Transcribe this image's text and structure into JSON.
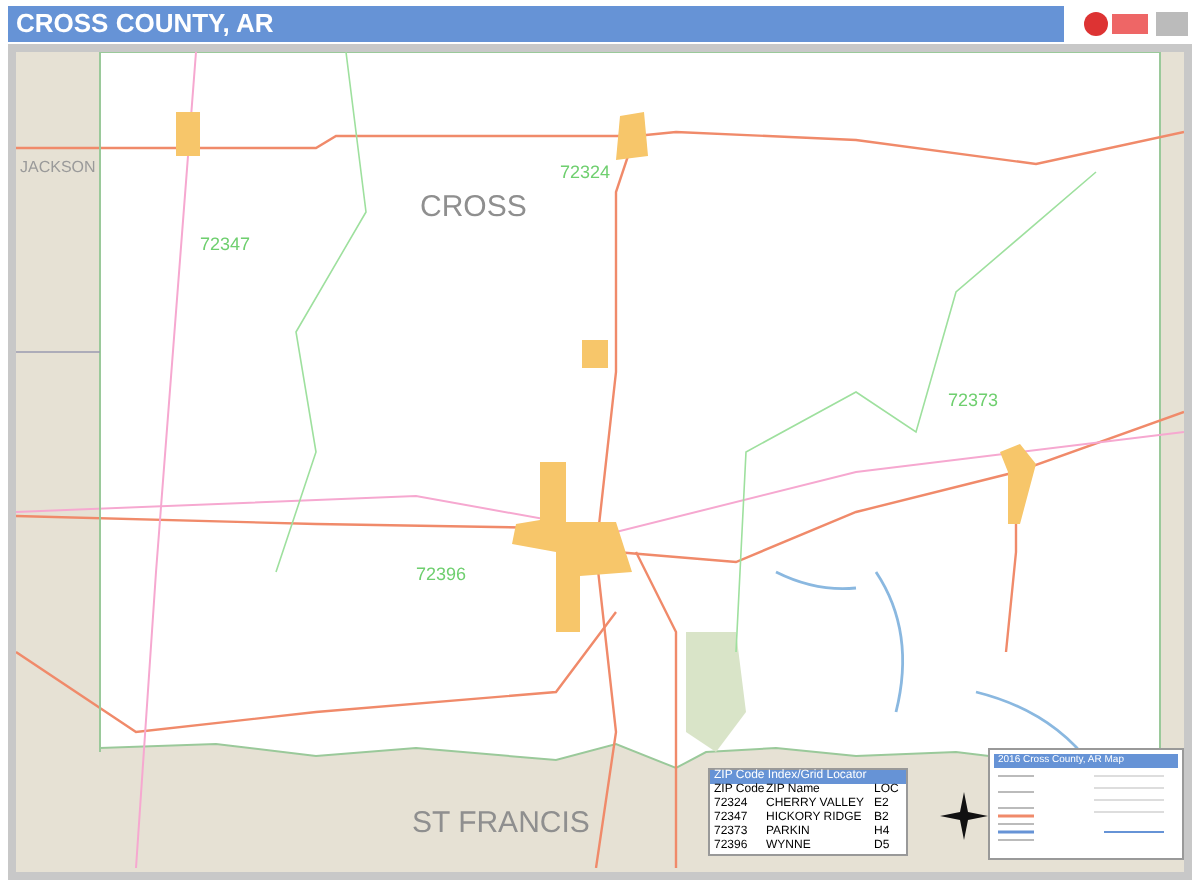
{
  "header": {
    "title": "CROSS COUNTY, AR"
  },
  "map_labels": [
    {
      "text": "JACKSON",
      "kind": "county"
    },
    {
      "text": "CROSS",
      "kind": "county"
    },
    {
      "text": "72324",
      "kind": "zip"
    },
    {
      "text": "72347",
      "kind": "zip"
    },
    {
      "text": "72373",
      "kind": "zip"
    },
    {
      "text": "72396",
      "kind": "zip"
    },
    {
      "text": "ST FRANCIS",
      "kind": "county"
    }
  ],
  "zip_index": {
    "title": "ZIP Code Index/Grid Locator",
    "columns": [
      "ZIP Code",
      "ZIP Name",
      "LOC"
    ],
    "rows": [
      [
        "72324",
        "CHERRY VALLEY",
        "E2"
      ],
      [
        "72347",
        "HICKORY RIDGE",
        "B2"
      ],
      [
        "72373",
        "PARKIN",
        "H4"
      ],
      [
        "72396",
        "WYNNE",
        "D5"
      ]
    ]
  },
  "legend": {
    "title": "2016 Cross County, AR Map"
  }
}
